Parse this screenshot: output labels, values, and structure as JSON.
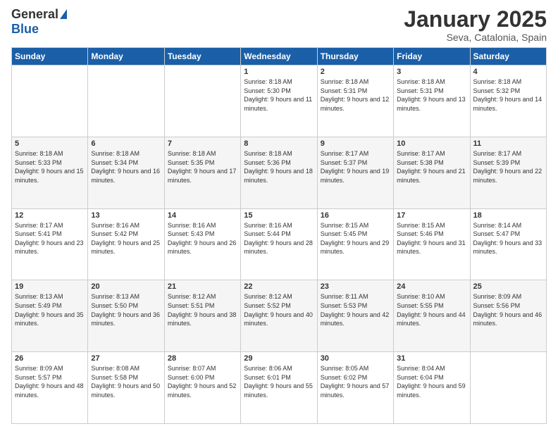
{
  "logo": {
    "general": "General",
    "blue": "Blue"
  },
  "title": {
    "month": "January 2025",
    "location": "Seva, Catalonia, Spain"
  },
  "weekdays": [
    "Sunday",
    "Monday",
    "Tuesday",
    "Wednesday",
    "Thursday",
    "Friday",
    "Saturday"
  ],
  "weeks": [
    [
      {
        "day": "",
        "info": ""
      },
      {
        "day": "",
        "info": ""
      },
      {
        "day": "",
        "info": ""
      },
      {
        "day": "1",
        "info": "Sunrise: 8:18 AM\nSunset: 5:30 PM\nDaylight: 9 hours and 11 minutes."
      },
      {
        "day": "2",
        "info": "Sunrise: 8:18 AM\nSunset: 5:31 PM\nDaylight: 9 hours and 12 minutes."
      },
      {
        "day": "3",
        "info": "Sunrise: 8:18 AM\nSunset: 5:31 PM\nDaylight: 9 hours and 13 minutes."
      },
      {
        "day": "4",
        "info": "Sunrise: 8:18 AM\nSunset: 5:32 PM\nDaylight: 9 hours and 14 minutes."
      }
    ],
    [
      {
        "day": "5",
        "info": "Sunrise: 8:18 AM\nSunset: 5:33 PM\nDaylight: 9 hours and 15 minutes."
      },
      {
        "day": "6",
        "info": "Sunrise: 8:18 AM\nSunset: 5:34 PM\nDaylight: 9 hours and 16 minutes."
      },
      {
        "day": "7",
        "info": "Sunrise: 8:18 AM\nSunset: 5:35 PM\nDaylight: 9 hours and 17 minutes."
      },
      {
        "day": "8",
        "info": "Sunrise: 8:18 AM\nSunset: 5:36 PM\nDaylight: 9 hours and 18 minutes."
      },
      {
        "day": "9",
        "info": "Sunrise: 8:17 AM\nSunset: 5:37 PM\nDaylight: 9 hours and 19 minutes."
      },
      {
        "day": "10",
        "info": "Sunrise: 8:17 AM\nSunset: 5:38 PM\nDaylight: 9 hours and 21 minutes."
      },
      {
        "day": "11",
        "info": "Sunrise: 8:17 AM\nSunset: 5:39 PM\nDaylight: 9 hours and 22 minutes."
      }
    ],
    [
      {
        "day": "12",
        "info": "Sunrise: 8:17 AM\nSunset: 5:41 PM\nDaylight: 9 hours and 23 minutes."
      },
      {
        "day": "13",
        "info": "Sunrise: 8:16 AM\nSunset: 5:42 PM\nDaylight: 9 hours and 25 minutes."
      },
      {
        "day": "14",
        "info": "Sunrise: 8:16 AM\nSunset: 5:43 PM\nDaylight: 9 hours and 26 minutes."
      },
      {
        "day": "15",
        "info": "Sunrise: 8:16 AM\nSunset: 5:44 PM\nDaylight: 9 hours and 28 minutes."
      },
      {
        "day": "16",
        "info": "Sunrise: 8:15 AM\nSunset: 5:45 PM\nDaylight: 9 hours and 29 minutes."
      },
      {
        "day": "17",
        "info": "Sunrise: 8:15 AM\nSunset: 5:46 PM\nDaylight: 9 hours and 31 minutes."
      },
      {
        "day": "18",
        "info": "Sunrise: 8:14 AM\nSunset: 5:47 PM\nDaylight: 9 hours and 33 minutes."
      }
    ],
    [
      {
        "day": "19",
        "info": "Sunrise: 8:13 AM\nSunset: 5:49 PM\nDaylight: 9 hours and 35 minutes."
      },
      {
        "day": "20",
        "info": "Sunrise: 8:13 AM\nSunset: 5:50 PM\nDaylight: 9 hours and 36 minutes."
      },
      {
        "day": "21",
        "info": "Sunrise: 8:12 AM\nSunset: 5:51 PM\nDaylight: 9 hours and 38 minutes."
      },
      {
        "day": "22",
        "info": "Sunrise: 8:12 AM\nSunset: 5:52 PM\nDaylight: 9 hours and 40 minutes."
      },
      {
        "day": "23",
        "info": "Sunrise: 8:11 AM\nSunset: 5:53 PM\nDaylight: 9 hours and 42 minutes."
      },
      {
        "day": "24",
        "info": "Sunrise: 8:10 AM\nSunset: 5:55 PM\nDaylight: 9 hours and 44 minutes."
      },
      {
        "day": "25",
        "info": "Sunrise: 8:09 AM\nSunset: 5:56 PM\nDaylight: 9 hours and 46 minutes."
      }
    ],
    [
      {
        "day": "26",
        "info": "Sunrise: 8:09 AM\nSunset: 5:57 PM\nDaylight: 9 hours and 48 minutes."
      },
      {
        "day": "27",
        "info": "Sunrise: 8:08 AM\nSunset: 5:58 PM\nDaylight: 9 hours and 50 minutes."
      },
      {
        "day": "28",
        "info": "Sunrise: 8:07 AM\nSunset: 6:00 PM\nDaylight: 9 hours and 52 minutes."
      },
      {
        "day": "29",
        "info": "Sunrise: 8:06 AM\nSunset: 6:01 PM\nDaylight: 9 hours and 55 minutes."
      },
      {
        "day": "30",
        "info": "Sunrise: 8:05 AM\nSunset: 6:02 PM\nDaylight: 9 hours and 57 minutes."
      },
      {
        "day": "31",
        "info": "Sunrise: 8:04 AM\nSunset: 6:04 PM\nDaylight: 9 hours and 59 minutes."
      },
      {
        "day": "",
        "info": ""
      }
    ]
  ]
}
